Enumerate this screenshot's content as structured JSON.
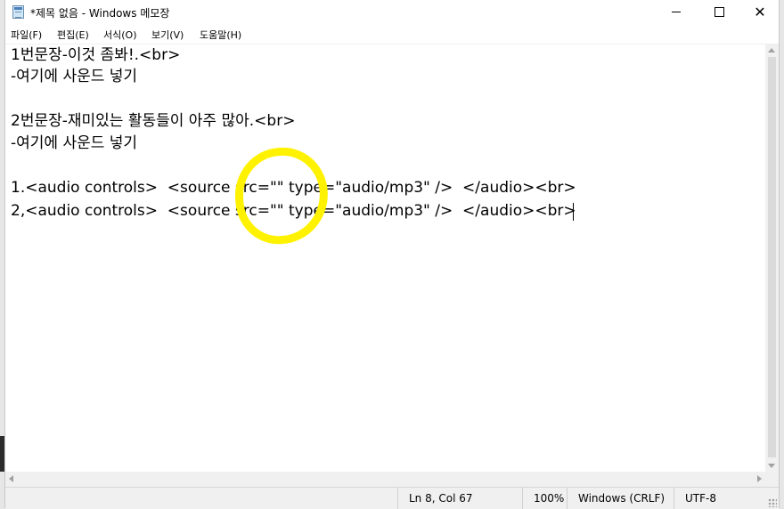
{
  "window": {
    "title": "*제목 없음 - Windows 메모장"
  },
  "menu": {
    "items": [
      "파일(F)",
      "편집(E)",
      "서식(O)",
      "보기(V)",
      "도움말(H)"
    ]
  },
  "editor": {
    "lines": [
      "1번문장-이것 좀봐!.<br>",
      "-여기에 사운드 넣기",
      "",
      "2번문장-재미있는 활동들이 아주 많아.<br>",
      "-여기에 사운드 넣기",
      "",
      "1.<audio controls>  <source src=\"\" type=\"audio/mp3\" />  </audio><br>",
      "2,<audio controls>  <source src=\"\" type=\"audio/mp3\" />  </audio><br>"
    ]
  },
  "statusbar": {
    "position": "Ln 8, Col 67",
    "zoom": "100%",
    "line_ending": "Windows (CRLF)",
    "encoding": "UTF-8"
  },
  "annotation": {
    "color": "#fff200"
  },
  "icons": {
    "app": "notepad-icon",
    "minimize": "minimize-icon",
    "maximize": "maximize-icon",
    "close": "close-icon"
  }
}
